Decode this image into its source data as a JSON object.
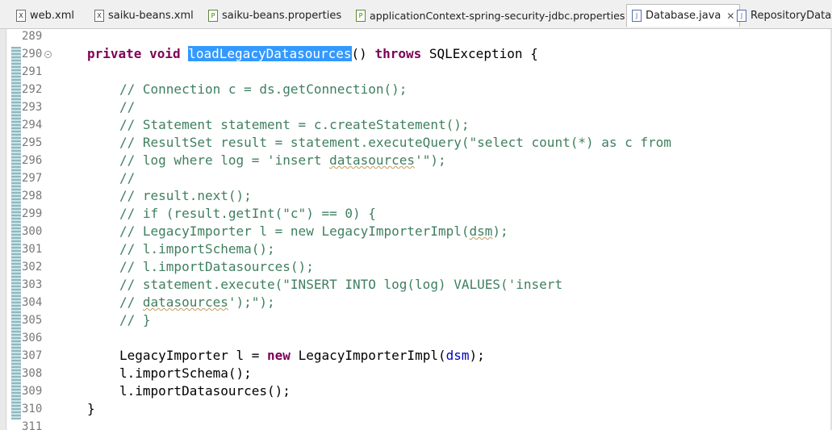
{
  "tabs": [
    {
      "label": "web.xml",
      "icon": "xml-file-icon",
      "glyph": "X"
    },
    {
      "label": "saiku-beans.xml",
      "icon": "xml-file-icon",
      "glyph": "X"
    },
    {
      "label": "saiku-beans.properties",
      "icon": "properties-file-icon",
      "glyph": "P"
    },
    {
      "label": "applicationContext-spring-security-jdbc.properties",
      "icon": "properties-file-icon",
      "glyph": "P"
    },
    {
      "label": "Database.java",
      "icon": "java-file-icon",
      "glyph": "J",
      "close": "✕",
      "active": true
    },
    {
      "label": "RepositoryDatasc",
      "icon": "java-file-icon",
      "glyph": "J"
    }
  ],
  "lines": {
    "l289": {
      "num": "289"
    },
    "l290": {
      "num": "290",
      "private": "private",
      "void": "void",
      "method": "loadLegacyDatasources",
      "parens": "()",
      "throws": "throws",
      "exc": " SQLException {"
    },
    "l291": {
      "num": "291"
    },
    "l292": {
      "num": "292",
      "text": "// Connection c = ds.getConnection();"
    },
    "l293": {
      "num": "293",
      "text": "//"
    },
    "l294": {
      "num": "294",
      "text": "// Statement statement = c.createStatement();"
    },
    "l295": {
      "num": "295",
      "text": "// ResultSet result = statement.executeQuery(\"select count(*) as c from"
    },
    "l296": {
      "num": "296",
      "pre": "// log where log = 'insert ",
      "sq": "datasources",
      "post": "'\");"
    },
    "l297": {
      "num": "297",
      "text": "//"
    },
    "l298": {
      "num": "298",
      "text": "// result.next();"
    },
    "l299": {
      "num": "299",
      "text": "// if (result.getInt(\"c\") == 0) {"
    },
    "l300": {
      "num": "300",
      "pre": "// LegacyImporter l = new LegacyImporterImpl(",
      "sq": "dsm",
      "post": ");"
    },
    "l301": {
      "num": "301",
      "text": "// l.importSchema();"
    },
    "l302": {
      "num": "302",
      "text": "// l.importDatasources();"
    },
    "l303": {
      "num": "303",
      "text": "// statement.execute(\"INSERT INTO log(log) VALUES('insert"
    },
    "l304": {
      "num": "304",
      "pre": "// ",
      "sq": "datasources",
      "post": "');\");"
    },
    "l305": {
      "num": "305",
      "text": "// }"
    },
    "l306": {
      "num": "306"
    },
    "l307": {
      "num": "307",
      "pre": "LegacyImporter l = ",
      "new": "new",
      "mid": " LegacyImporterImpl(",
      "field": "dsm",
      "post": ");"
    },
    "l308": {
      "num": "308",
      "text": "l.importSchema();"
    },
    "l309": {
      "num": "309",
      "text": "l.importDatasources();"
    },
    "l310": {
      "num": "310",
      "text": "}"
    },
    "l311": {
      "num": "311"
    }
  },
  "colors": {
    "keyword": "#7f0055",
    "comment": "#3f7f5f",
    "field": "#0000c0",
    "selection": "#3399ff",
    "line_number": "#787878"
  }
}
